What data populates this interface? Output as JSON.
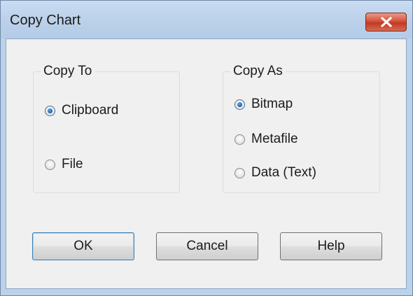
{
  "window": {
    "title": "Copy Chart"
  },
  "copy_to": {
    "title": "Copy To",
    "options": [
      {
        "label": "Clipboard",
        "checked": true
      },
      {
        "label": "File",
        "checked": false
      }
    ]
  },
  "copy_as": {
    "title": "Copy As",
    "options": [
      {
        "label": "Bitmap",
        "checked": true
      },
      {
        "label": "Metafile",
        "checked": false
      },
      {
        "label": "Data (Text)",
        "checked": false
      }
    ]
  },
  "buttons": {
    "ok": "OK",
    "cancel": "Cancel",
    "help": "Help"
  },
  "icons": {
    "close": "close-icon"
  },
  "colors": {
    "titlebar": "#bcd1ea",
    "close_button": "#c94a33",
    "client_background": "#f0f0f0"
  }
}
